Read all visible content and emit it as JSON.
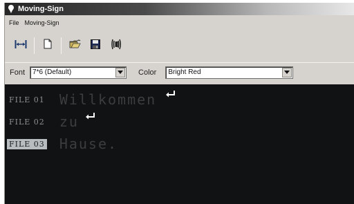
{
  "window": {
    "title": "Moving-Sign"
  },
  "menu": {
    "items": [
      "File",
      "Moving-Sign"
    ]
  },
  "toolbar": {
    "buttons": [
      {
        "icon": "width-adjust-icon"
      },
      {
        "icon": "new-document-icon"
      },
      {
        "icon": "open-folder-icon"
      },
      {
        "icon": "save-disk-icon"
      },
      {
        "icon": "transmit-icon"
      }
    ]
  },
  "fontbar": {
    "font_label": "Font",
    "font_value": "7*6 (Default)",
    "color_label": "Color",
    "color_value": "Bright Red"
  },
  "files": [
    {
      "label": "FILE 01",
      "text": "Willkommen",
      "return_mark": true,
      "selected": false
    },
    {
      "label": "FILE 02",
      "text": "zu",
      "return_mark": true,
      "selected": false
    },
    {
      "label": "FILE 03",
      "text": "Hause.",
      "return_mark": false,
      "selected": true
    }
  ],
  "colors": {
    "screen_bg": "#101214",
    "label_text": "#8c8f92",
    "selected_bg": "#b9bcbe"
  }
}
